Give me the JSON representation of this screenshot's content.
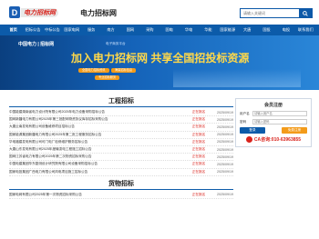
{
  "header": {
    "logo_mark": "D",
    "logo_text": "电力招标网",
    "site_title": "电力招标网",
    "search_placeholder": "请输入关键词"
  },
  "nav": [
    "首页",
    "招标公告",
    "中标公告",
    "国家电网",
    "服务",
    "南方",
    "国网",
    "采购",
    "国电",
    "华电",
    "华能",
    "国家能源",
    "大唐",
    "国投",
    "电投",
    "联系我们"
  ],
  "banner": {
    "tag": "中国电力 | 招标网",
    "sub": "电子商务平台",
    "headline": "加入电力招标网 共享全国招投标资源",
    "pills": [
      "全国电力招标资讯",
      "海量招标信息",
      "专业招标服务"
    ]
  },
  "sections": {
    "project": {
      "title": "工程招标",
      "rows": [
        {
          "title": "中国能建湖南省电力设计院有限公司2025年电力设备采购招标公告",
          "status": "正在报名",
          "date": "2025/09/19"
        },
        {
          "title": "国网新疆电力有限公司2025年第三批配网物资协议库存招标采购公告",
          "status": "正在报名",
          "date": "2025/09/19"
        },
        {
          "title": "大唐云南发电有限公司设备维修项目招标公告",
          "status": "正在报名",
          "date": "2025/09/19"
        },
        {
          "title": "国家能源集团新疆电力有限公司2025年第二批工程服务招标公告",
          "status": "正在报名",
          "date": "2025/09/19"
        },
        {
          "title": "华电福建发电有限公司可门电厂检修维护服务招标公告",
          "status": "正在报名",
          "date": "2025/09/19"
        },
        {
          "title": "大唐山东发电有限公司2025年度输变电工程施工招标公告",
          "status": "正在报名",
          "date": "2025/09/19"
        },
        {
          "title": "国网江苏省电力有限公司2025年第二次物资招标采购公告",
          "status": "正在报名",
          "date": "2025/09/19"
        },
        {
          "title": "中国电建集团华东勘测设计研究院有限公司设备采购招标公告",
          "status": "正在报名",
          "date": "2025/09/19"
        },
        {
          "title": "国家电投集团广西电力有限公司风电项目施工招标公告",
          "status": "正在报名",
          "date": "2025/09/19"
        }
      ]
    },
    "goods": {
      "title": "货物招标",
      "rows": [
        {
          "title": "国家电网有限公司2025年第一次物资招标采购公告",
          "status": "正在报名",
          "date": "2025/09/19"
        }
      ]
    }
  },
  "login": {
    "title": "会员注册",
    "user_label": "用户名",
    "user_placeholder": "请输入用户名",
    "pass_label": "密码",
    "pass_placeholder": "请输入密码",
    "login_btn": "登录",
    "register_btn": "免费注册",
    "phone": "CA咨询:010-63963855"
  },
  "colors": {
    "brand": "#0c5ba9",
    "accent": "#d9231c",
    "banner_text": "#ffd84a"
  }
}
